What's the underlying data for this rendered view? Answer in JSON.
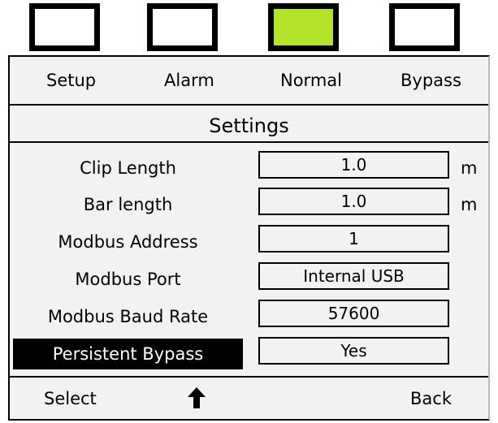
{
  "indicators": [
    {
      "name": "lamp-1",
      "state": "off",
      "color": "#ffffff"
    },
    {
      "name": "lamp-2",
      "state": "off",
      "color": "#ffffff"
    },
    {
      "name": "lamp-3",
      "state": "on",
      "color": "#b4e32c"
    },
    {
      "name": "lamp-4",
      "state": "off",
      "color": "#ffffff"
    }
  ],
  "tabs": [
    {
      "label": "Setup"
    },
    {
      "label": "Alarm"
    },
    {
      "label": "Normal"
    },
    {
      "label": "Bypass"
    }
  ],
  "title": "Settings",
  "settings": [
    {
      "label": "Clip Length",
      "value": "1.0",
      "unit": "m"
    },
    {
      "label": "Bar length",
      "value": "1.0",
      "unit": "m"
    },
    {
      "label": "Modbus Address",
      "value": "1"
    },
    {
      "label": "Modbus Port",
      "value": "Internal USB"
    },
    {
      "label": "Modbus Baud Rate",
      "value": "57600"
    },
    {
      "label": "Persistent Bypass",
      "value": "Yes",
      "selected": true
    }
  ],
  "footer": {
    "select": "Select",
    "up_icon": "up-arrow-icon",
    "back": "Back"
  },
  "colors": {
    "indicator_active": "#b4e32c",
    "panel_background": "#f2f2f2",
    "selection_background": "#000000",
    "selection_text": "#ffffff"
  }
}
